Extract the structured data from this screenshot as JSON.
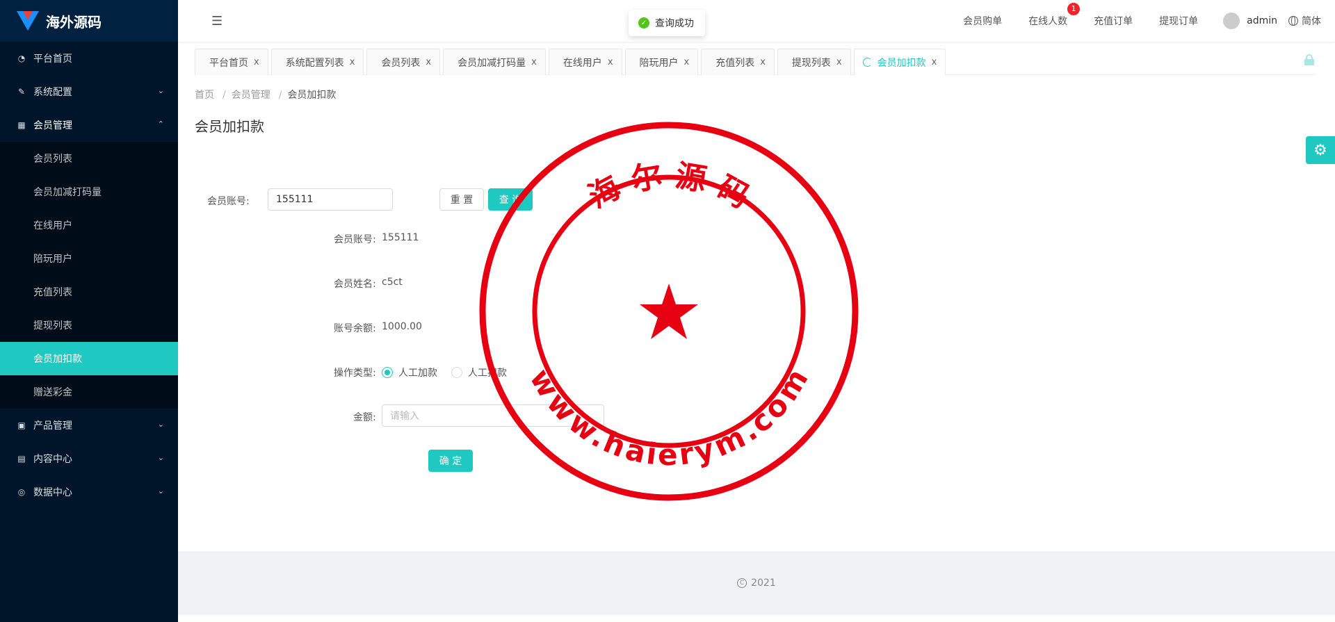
{
  "app": {
    "title": "海外源码"
  },
  "sidebar": {
    "items": [
      {
        "label": "平台首页",
        "icon": "dashboard-icon",
        "has_arrow": false
      },
      {
        "label": "系统配置",
        "icon": "edit-icon",
        "has_arrow": true,
        "arrow": "⌄"
      },
      {
        "label": "会员管理",
        "icon": "table-icon",
        "has_arrow": true,
        "arrow": "⌃",
        "open": true
      },
      {
        "label": "产品管理",
        "icon": "appstore-icon",
        "has_arrow": true,
        "arrow": "⌄"
      },
      {
        "label": "内容中心",
        "icon": "profile-icon",
        "has_arrow": true,
        "arrow": "⌄"
      },
      {
        "label": "数据中心",
        "icon": "check-circle-icon",
        "has_arrow": true,
        "arrow": "⌄"
      }
    ],
    "submenu": [
      {
        "label": "会员列表"
      },
      {
        "label": "会员加减打码量"
      },
      {
        "label": "在线用户"
      },
      {
        "label": "陪玩用户"
      },
      {
        "label": "充值列表"
      },
      {
        "label": "提现列表"
      },
      {
        "label": "会员加扣款",
        "active": true
      },
      {
        "label": "赠送彩金"
      }
    ]
  },
  "header": {
    "links": [
      "会员购单",
      "在线人数",
      "充值订单",
      "提现订单"
    ],
    "online_badge": "1",
    "username": "admin",
    "language": "简体"
  },
  "toast": {
    "message": "查询成功"
  },
  "tabs": [
    {
      "label": "平台首页"
    },
    {
      "label": "系统配置列表"
    },
    {
      "label": "会员列表"
    },
    {
      "label": "会员加减打码量"
    },
    {
      "label": "在线用户"
    },
    {
      "label": "陪玩用户"
    },
    {
      "label": "充值列表"
    },
    {
      "label": "提现列表"
    },
    {
      "label": "会员加扣款",
      "active": true
    }
  ],
  "tab_close": "x",
  "breadcrumb": {
    "items": [
      "首页",
      "会员管理",
      "会员加扣款"
    ],
    "separator": "/"
  },
  "page_title": "会员加扣款",
  "search": {
    "account_label": "会员账号:",
    "account_value": "155111",
    "reset_label": "重 置",
    "query_label": "查 询"
  },
  "detail": {
    "account_label": "会员账号:",
    "account_value": "155111",
    "name_label": "会员姓名:",
    "name_value": "c5ct",
    "balance_label": "账号余额:",
    "balance_value": "1000.00",
    "op_label": "操作类型:",
    "op_options": [
      "人工加款",
      "人工扣款"
    ],
    "op_selected": 0,
    "amount_label": "金额:",
    "amount_placeholder": "请输入",
    "confirm_label": "确 定"
  },
  "footer": {
    "copyright_symbol": "C",
    "year": "2021"
  },
  "watermark": {
    "top_text": "海 尔 源 码",
    "bottom_text": "www.haierym.com",
    "color": "#e60012"
  },
  "colors": {
    "accent": "#1fc8c0",
    "sidebar": "#001529",
    "badge": "#f5222d",
    "success": "#52c41a"
  }
}
